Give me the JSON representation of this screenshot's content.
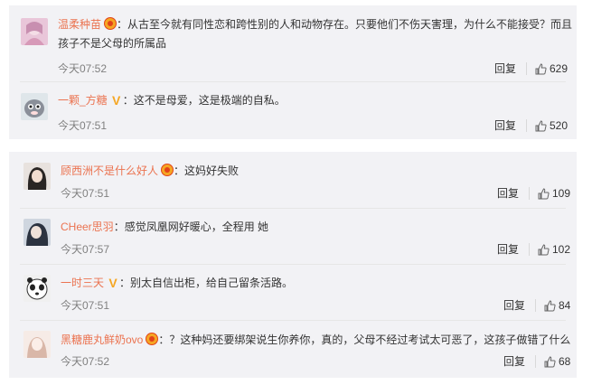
{
  "panel1": {
    "comments": [
      {
        "username": "温柔种苗",
        "text_line1": "从古至今就有同性恋和跨性别的人和动物存在。只要他们不伤天害理，为什么不能接受？而且",
        "text_line2": "孩子不是父母的所属品",
        "time": "今天07:52",
        "reply": "回复",
        "likes": "629"
      },
      {
        "username": "一颗_方糖",
        "text_line1": "这不是母爱，这是极端的自私。",
        "time": "今天07:51",
        "reply": "回复",
        "likes": "520"
      }
    ]
  },
  "panel2": {
    "comments": [
      {
        "username": "顾西洲不是什么好人",
        "text_line1": "这妈好失败",
        "time": "今天07:51",
        "reply": "回复",
        "likes": "109"
      },
      {
        "username": "CHeer思羽",
        "text_line1": "感觉凤凰网好暖心，全程用 她",
        "time": "今天07:57",
        "reply": "回复",
        "likes": "102"
      },
      {
        "username": "一时三天",
        "text_line1": "别太自信出柜，给自己留条活路。",
        "time": "今天07:51",
        "reply": "回复",
        "likes": "84"
      },
      {
        "username": "黑糖鹿丸鲜奶ovo",
        "text_line1": "？这种妈还要绑架说生你养你，真的，父母不经过考试太可恶了，这孩子做错了什么",
        "time": "今天07:52",
        "reply": "回复",
        "likes": "68"
      }
    ]
  },
  "colon": "：",
  "icons": {
    "thumb": "thumb-up-icon",
    "badge": "emoji-badge-icon",
    "vip": "vip-v-icon"
  },
  "colors": {
    "username": "#eb7350",
    "panel_bg": "#f2f2f5",
    "time": "#808080",
    "badge": "#f5a623"
  }
}
